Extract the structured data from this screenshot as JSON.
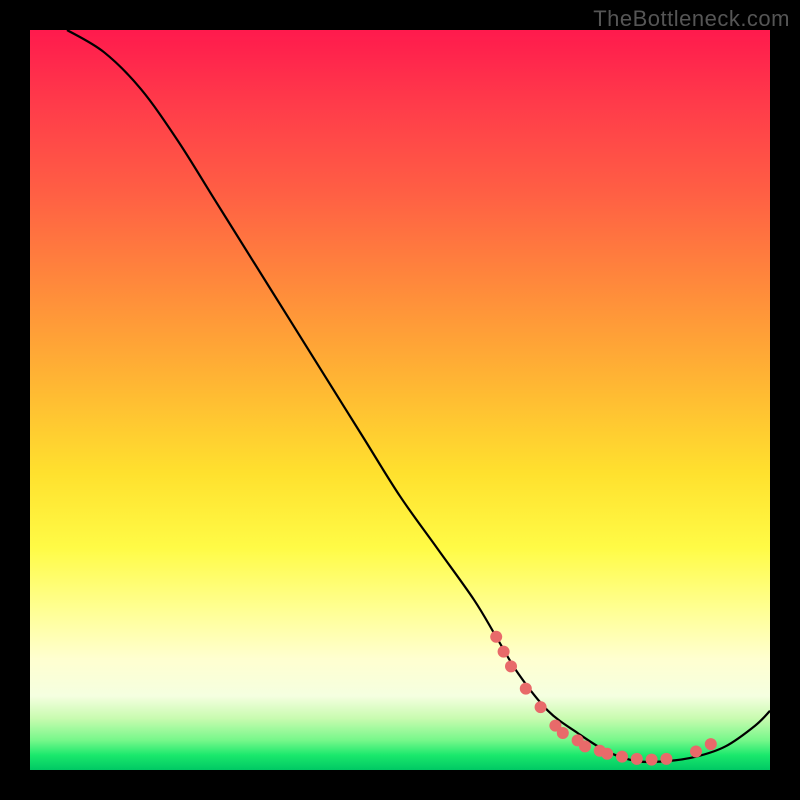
{
  "watermark": "TheBottleneck.com",
  "chart_data": {
    "type": "line",
    "title": "",
    "xlabel": "",
    "ylabel": "",
    "xlim": [
      0,
      100
    ],
    "ylim": [
      0,
      100
    ],
    "series": [
      {
        "name": "bottleneck-curve",
        "x": [
          5,
          10,
          15,
          20,
          25,
          30,
          35,
          40,
          45,
          50,
          55,
          60,
          63,
          66,
          70,
          74,
          78,
          82,
          86,
          90,
          94,
          98,
          100
        ],
        "y": [
          100,
          97,
          92,
          85,
          77,
          69,
          61,
          53,
          45,
          37,
          30,
          23,
          18,
          13,
          8,
          5,
          2.5,
          1.2,
          1.2,
          1.8,
          3.2,
          6,
          8
        ]
      }
    ],
    "markers": {
      "name": "highlight-points",
      "color": "#e86a6a",
      "radius": 6,
      "x": [
        63,
        64,
        65,
        67,
        69,
        71,
        72,
        74,
        75,
        77,
        78,
        80,
        82,
        84,
        86,
        90,
        92
      ],
      "y": [
        18,
        16,
        14,
        11,
        8.5,
        6,
        5,
        4,
        3.2,
        2.6,
        2.2,
        1.8,
        1.5,
        1.4,
        1.5,
        2.5,
        3.5
      ]
    }
  }
}
